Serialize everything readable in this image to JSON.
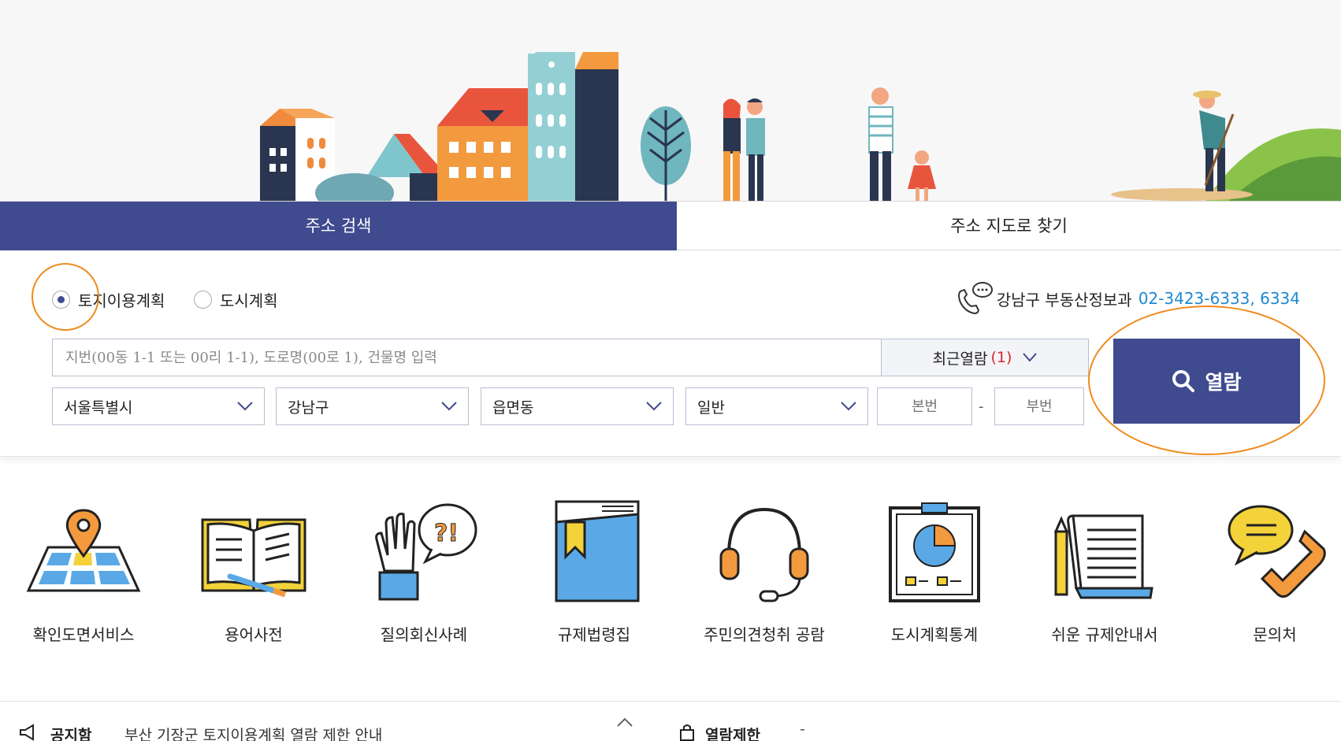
{
  "tabs": {
    "address_search": "주소 검색",
    "map_search": "주소 지도로 찾기"
  },
  "radio": {
    "land_use": "토지이용계획",
    "city_plan": "도시계획",
    "selected": "land_use"
  },
  "contact": {
    "department": "강남구 부동산정보과",
    "phone": "02-3423-6333, 6334"
  },
  "search": {
    "placeholder": "지번(00동 1-1 또는 00리 1-1), 도로명(00로 1), 건물명 입력",
    "recent_label": "최근열람",
    "recent_count": "(1)"
  },
  "selects": {
    "city": "서울특별시",
    "district": "강남구",
    "dong": "읍면동",
    "type": "일반"
  },
  "lot": {
    "main_placeholder": "본번",
    "sub_placeholder": "부번",
    "separator": "-"
  },
  "view_button": "열람",
  "services": [
    {
      "label": "확인도면서비스",
      "icon": "map-pin-icon"
    },
    {
      "label": "용어사전",
      "icon": "open-book-icon"
    },
    {
      "label": "질의회신사례",
      "icon": "question-hand-icon"
    },
    {
      "label": "규제법령집",
      "icon": "law-book-icon"
    },
    {
      "label": "주민의견청취 공람",
      "icon": "headset-icon"
    },
    {
      "label": "도시계획통계",
      "icon": "pie-chart-clipboard-icon"
    },
    {
      "label": "쉬운 규제안내서",
      "icon": "document-pencil-icon"
    },
    {
      "label": "문의처",
      "icon": "phone-chat-icon"
    }
  ],
  "bottom": {
    "notice_title": "공지함",
    "notice_text": "부산 기장군 토지이용계획 열람 제한 안내",
    "restrict_title": "열람제한",
    "restrict_value": "-"
  },
  "colors": {
    "primary": "#3f4a8f",
    "accent_orange": "#f08a1c",
    "link_blue": "#1e88d2",
    "count_red": "#d8282c"
  }
}
